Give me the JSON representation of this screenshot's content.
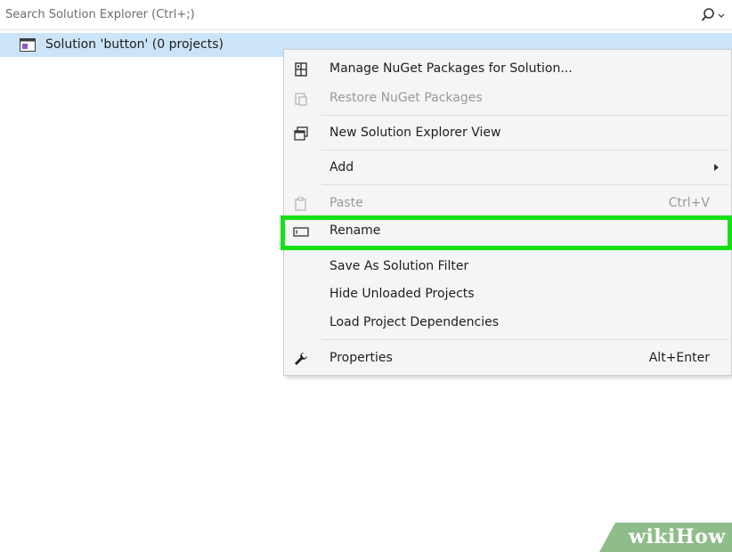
{
  "search": {
    "placeholder": "Search Solution Explorer (Ctrl+;)",
    "icon": "search-icon"
  },
  "tree": {
    "solution_label": "Solution 'button' (0 projects)",
    "solution_icon": "solution-icon"
  },
  "context_menu": {
    "items": [
      {
        "label": "Manage NuGet Packages for Solution...",
        "icon": "nuget-icon",
        "shortcut": "",
        "disabled": false
      },
      {
        "label": "Restore NuGet Packages",
        "icon": "restore-icon",
        "shortcut": "",
        "disabled": true
      },
      {
        "label": "New Solution Explorer View",
        "icon": "new-view-icon",
        "shortcut": "",
        "disabled": false
      },
      {
        "label": "Add",
        "icon": "",
        "shortcut": "",
        "disabled": false,
        "submenu": true
      },
      {
        "label": "Paste",
        "icon": "paste-icon",
        "shortcut": "Ctrl+V",
        "disabled": true
      },
      {
        "label": "Rename",
        "icon": "rename-icon",
        "shortcut": "",
        "disabled": false,
        "highlighted": true
      },
      {
        "label": "Save As Solution Filter",
        "icon": "",
        "shortcut": "",
        "disabled": false
      },
      {
        "label": "Hide Unloaded Projects",
        "icon": "",
        "shortcut": "",
        "disabled": false
      },
      {
        "label": "Load Project Dependencies",
        "icon": "",
        "shortcut": "",
        "disabled": false
      },
      {
        "label": "Properties",
        "icon": "wrench-icon",
        "shortcut": "Alt+Enter",
        "disabled": false
      }
    ]
  },
  "colors": {
    "selection": "#cce4f7",
    "highlight_box": "#16e016",
    "menu_background": "#f5f5f5",
    "watermark": "#8fbc8b"
  },
  "watermark": {
    "text": "wikiHow"
  }
}
